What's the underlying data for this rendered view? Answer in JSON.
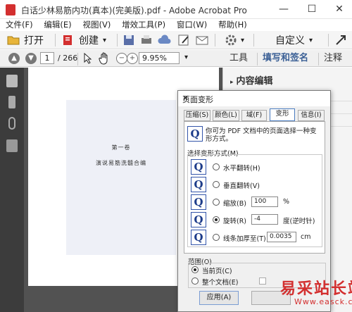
{
  "window": {
    "title": "白话少林易筋内功(真本)(完美版).pdf - Adobe Acrobat Pro",
    "min": "—",
    "max": "☐",
    "close": "✕"
  },
  "menu": [
    "文件(F)",
    "编辑(E)",
    "视图(V)",
    "增效工具(P)",
    "窗口(W)",
    "帮助(H)"
  ],
  "toolbar": {
    "open": "打开",
    "create": "创建",
    "create_arrow": "▾",
    "customize": "自定义",
    "customize_arrow": "▾"
  },
  "nav": {
    "page_current": "1",
    "page_total": "/ 266",
    "zoom": "9.95%",
    "zoom_arrow": "▾"
  },
  "right_tabs": [
    "工具",
    "填写和签名",
    "注释"
  ],
  "right_panel": {
    "header": "内容编辑"
  },
  "document": {
    "line1": "第一卷",
    "line2": "演说易筋洗髓合编"
  },
  "dialog": {
    "title": "页面变形",
    "close": "✕",
    "tabs": [
      "压缩(S)",
      "颜色(L)",
      "域(F)",
      "变形",
      "信息(I)"
    ],
    "active_tab": 3,
    "description": "你可为 PDF 文档中的页面选择一种变形方式。",
    "group_label": "选择变形方式(M)",
    "options": [
      {
        "label": "水平翻转(H)",
        "selected": false
      },
      {
        "label": "垂直翻转(V)",
        "selected": false
      },
      {
        "label": "缩放(B)",
        "selected": false,
        "value": "100",
        "unit": "%"
      },
      {
        "label": "旋转(R)",
        "selected": true,
        "value": "-4",
        "unit": "度(逆时针)"
      },
      {
        "label": "线条加厚至(T)",
        "selected": false,
        "value": "0.0035",
        "unit": "cm"
      }
    ],
    "range_label": "范围(O)",
    "range_options": [
      {
        "label": "当前页(C)",
        "selected": true
      },
      {
        "label": "整个文档(E)",
        "selected": false
      }
    ],
    "apply_button": "应用(A)"
  },
  "watermark": {
    "text": "易采站长站",
    "url": "Www.easck.com"
  },
  "colors": {
    "accent": "#1d3c8a",
    "watermark": "#d32f2f"
  }
}
